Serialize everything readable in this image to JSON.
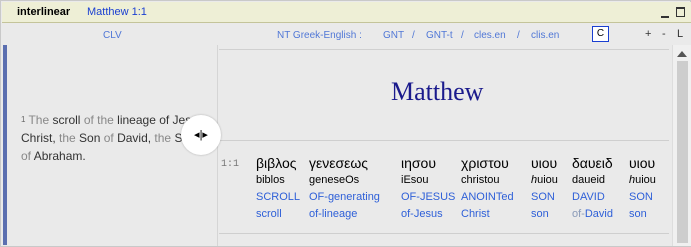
{
  "window": {
    "app_title": "interlinear",
    "reference": "Matthew 1:1"
  },
  "toolbar": {
    "left_label": "CLV",
    "module_label": "NT Greek-English :",
    "modules": [
      "GNT",
      "GNT-t",
      "cles.en",
      "clis.en"
    ],
    "separators": [
      "/",
      "/",
      "/"
    ],
    "c_button": "C",
    "plus": "+",
    "minus": "-",
    "l_button": "L"
  },
  "left_pane": {
    "verse_number": "1",
    "segments": [
      {
        "text": "The ",
        "gray": true
      },
      {
        "text": "scroll ",
        "gray": false
      },
      {
        "text": "of ",
        "gray": true
      },
      {
        "text": "the ",
        "gray": true
      },
      {
        "text": "lineage ",
        "gray": false
      },
      {
        "text": "of Jesus Christ, ",
        "gray": false
      },
      {
        "text": "the ",
        "gray": true
      },
      {
        "text": "Son ",
        "gray": false
      },
      {
        "text": "of ",
        "gray": true
      },
      {
        "text": "David, ",
        "gray": false
      },
      {
        "text": "the ",
        "gray": true
      },
      {
        "text": "Son ",
        "gray": false
      },
      {
        "text": "of ",
        "gray": true
      },
      {
        "text": "Abraham.",
        "gray": false
      }
    ]
  },
  "right_pane": {
    "book_title": "Matthew",
    "verse_ref": "1:1",
    "words": [
      {
        "greek": "βιβλος",
        "translit": "biblos",
        "translit_italic_prefix": "",
        "en1": "SCROLL",
        "en2": "scroll",
        "en2_gray_prefix": ""
      },
      {
        "greek": "γενεσεως",
        "translit": "geneseOs",
        "translit_italic_prefix": "",
        "en1": "OF-generating",
        "en2": "of-lineage",
        "en2_gray_prefix": ""
      },
      {
        "greek": "ιησου",
        "translit": "iEsou",
        "translit_italic_prefix": "",
        "en1": "OF-JESUS",
        "en2": "of-Jesus",
        "en2_gray_prefix": ""
      },
      {
        "greek": "χριστου",
        "translit": "christou",
        "translit_italic_prefix": "",
        "en1": "ANOINTed",
        "en2": "Christ",
        "en2_gray_prefix": ""
      },
      {
        "greek": "υιου",
        "translit": "uiou",
        "translit_italic_prefix": "h",
        "en1": "SON",
        "en2": "son",
        "en2_gray_prefix": ""
      },
      {
        "greek": "δαυειδ",
        "translit": "daueid",
        "translit_italic_prefix": "",
        "en1": "DAVID",
        "en2": "David",
        "en2_gray_prefix": "of-"
      },
      {
        "greek": "υιου",
        "translit": "uiou",
        "translit_italic_prefix": "h",
        "en1": "SON",
        "en2": "son",
        "en2_gray_prefix": ""
      }
    ]
  },
  "colors": {
    "title_bar": "#eeefd6",
    "link_blue": "#2f60d8",
    "book_title": "#1a1a8c",
    "pane_bg": "#eaeaea"
  },
  "icons": {
    "splitter": "resize-horizontal-icon",
    "minimize": "minimize-icon",
    "maximize": "maximize-icon"
  }
}
